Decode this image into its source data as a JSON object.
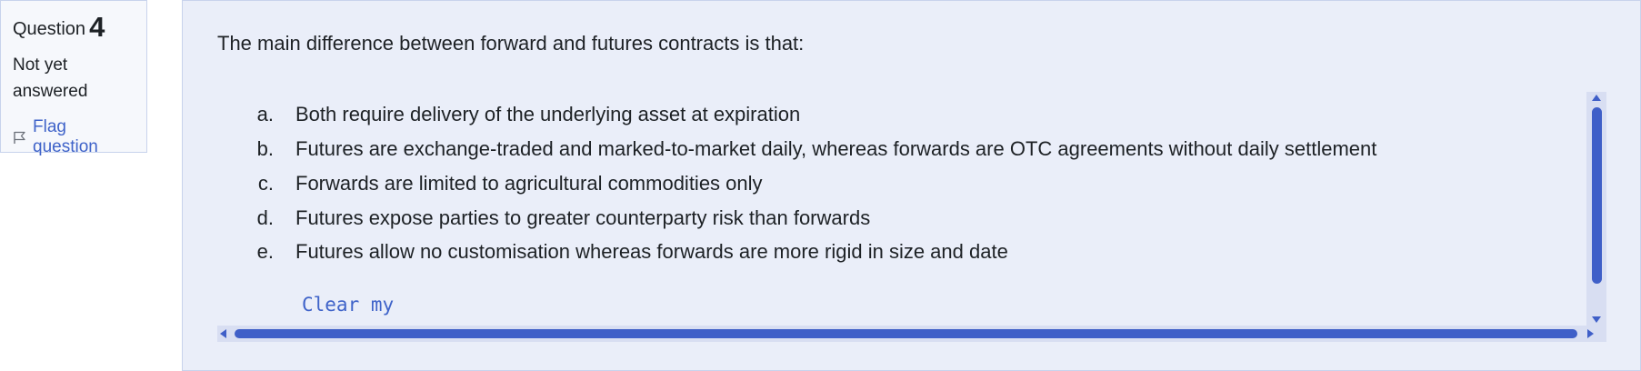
{
  "question_info": {
    "label": "Question",
    "number": "4",
    "state": "Not yet answered",
    "flag_label": "Flag question",
    "flag_icon": "flag-outline-icon"
  },
  "question": {
    "text": "The main difference between forward and futures contracts is that:",
    "options": [
      {
        "letter": "a.",
        "text": "Both require delivery of the underlying asset at expiration"
      },
      {
        "letter": "b.",
        "text": "Futures are exchange-traded and marked-to-market daily, whereas forwards are OTC agreements without daily settlement"
      },
      {
        "letter": "c.",
        "text": "Forwards are limited to agricultural commodities only"
      },
      {
        "letter": "d.",
        "text": "Futures expose parties to greater counterparty risk than forwards"
      },
      {
        "letter": "e.",
        "text": "Futures allow no customisation whereas forwards are more rigid in size and date"
      }
    ],
    "clear_label": "Clear my"
  },
  "colors": {
    "accent": "#3f63c9",
    "panel_bg": "#eaeef9",
    "info_bg": "#f6f8fc",
    "border": "#c8d3ec",
    "scroll_track": "#d8def2",
    "scroll_thumb": "#3f5fc8"
  }
}
